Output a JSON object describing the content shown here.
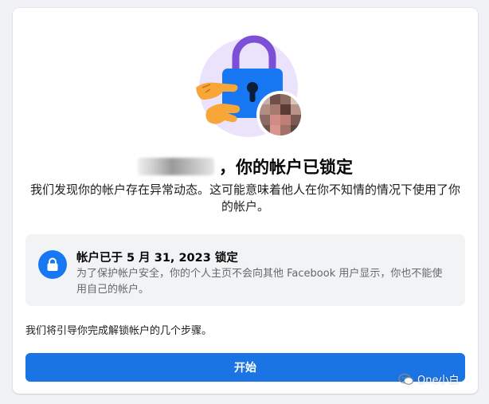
{
  "header": {
    "title_suffix": "，你的帐户已锁定"
  },
  "description": "我们发现你的帐户存在异常动态。这可能意味着他人在你不知情的情况下使用了你的帐户。",
  "lock_notice": {
    "icon": "lock-icon",
    "title": "帐户已于 5 月 31, 2023 锁定",
    "subtitle": "为了保护帐户安全，你的个人主页不会向其他 Facebook 用户显示，你也不能使用自己的帐户。"
  },
  "steps_text": "我们将引导你完成解锁帐户的几个步骤。",
  "start_button": {
    "label": "开始"
  },
  "watermark": {
    "text": "One小白",
    "icon": "wechat-icon"
  },
  "colors": {
    "primary": "#1b74e4",
    "lock_circle": "#1877f2",
    "info_bg": "#f2f3f5",
    "page_bg": "#f0f2f5"
  }
}
